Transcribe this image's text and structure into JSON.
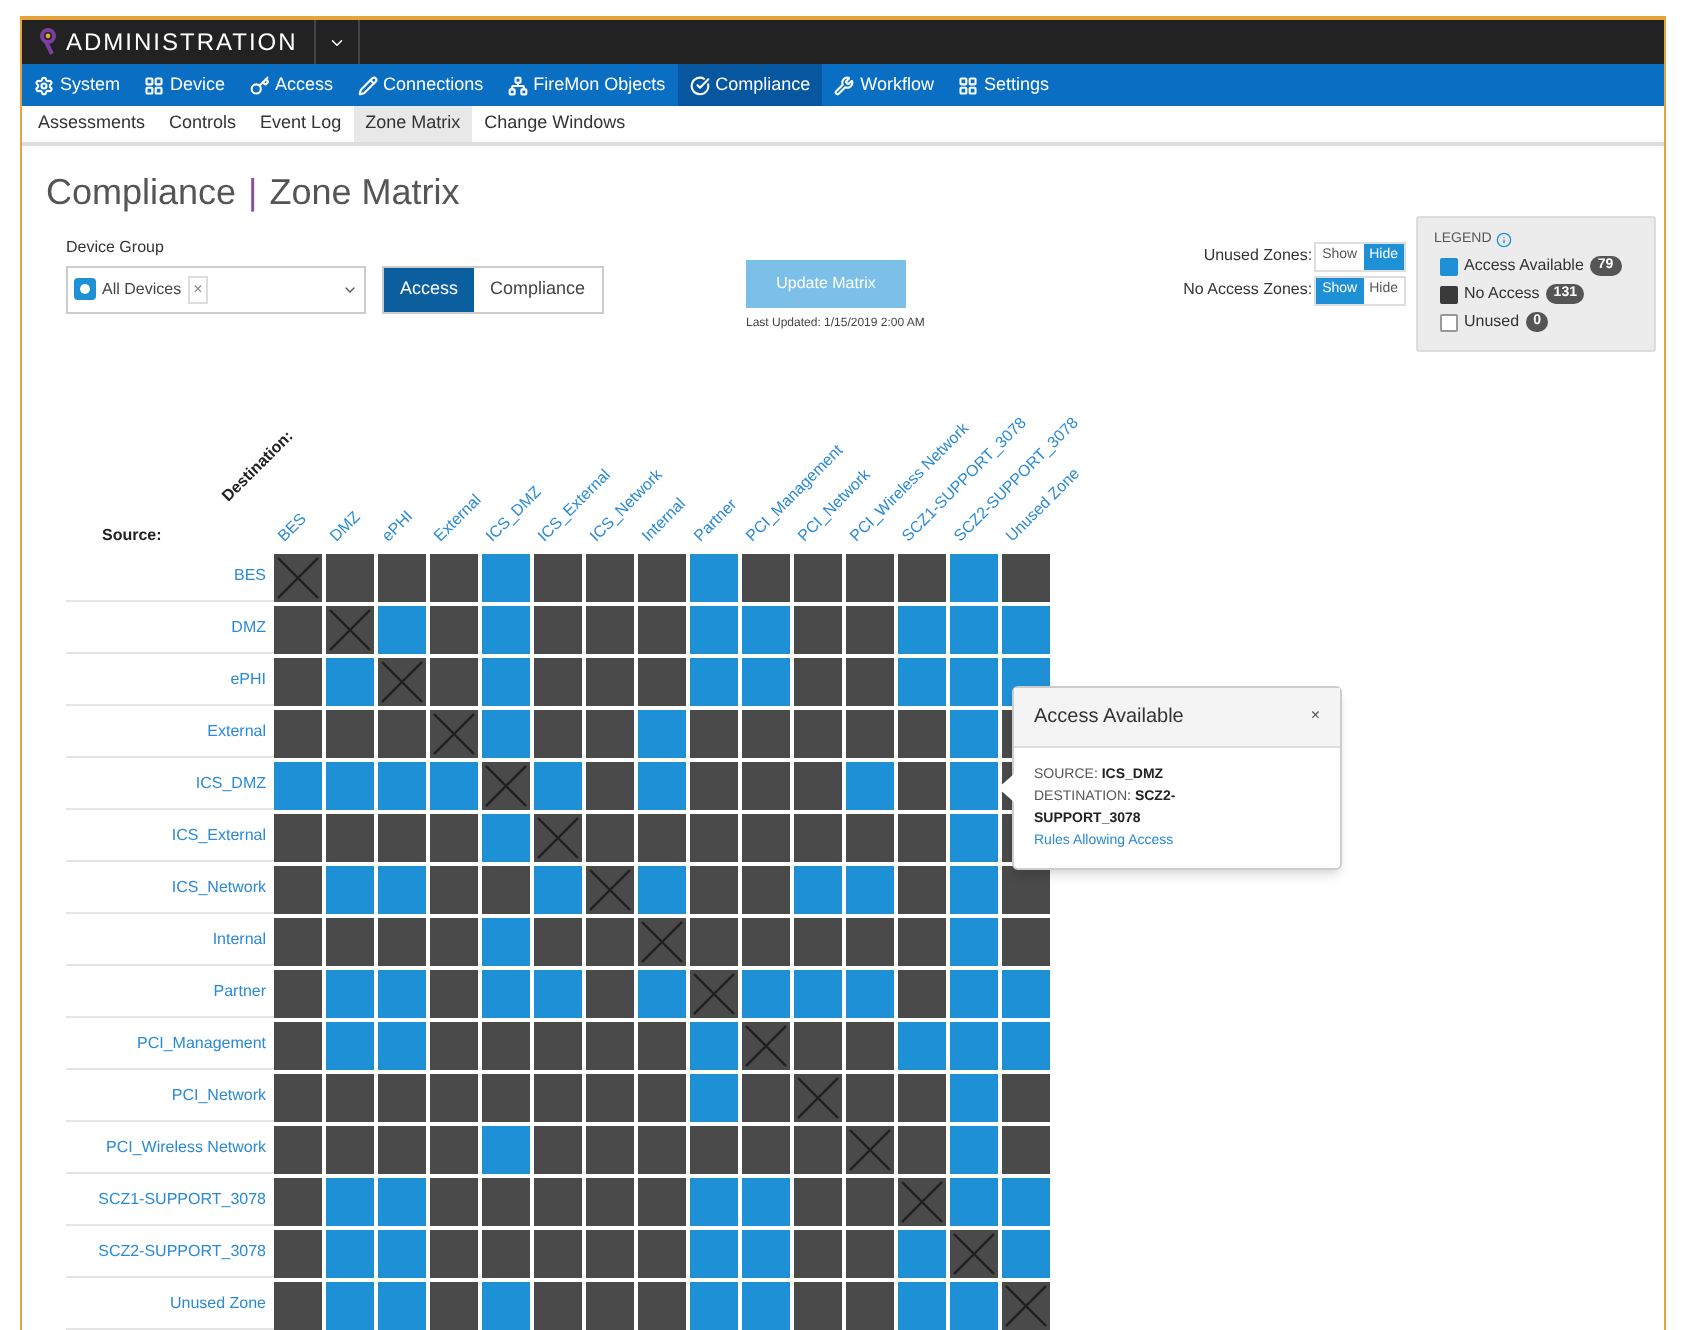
{
  "header": {
    "title": "ADMINISTRATION"
  },
  "nav": [
    {
      "label": "System",
      "selected": false
    },
    {
      "label": "Device",
      "selected": false
    },
    {
      "label": "Access",
      "selected": false
    },
    {
      "label": "Connections",
      "selected": false
    },
    {
      "label": "FireMon Objects",
      "selected": false
    },
    {
      "label": "Compliance",
      "selected": true
    },
    {
      "label": "Workflow",
      "selected": false
    },
    {
      "label": "Settings",
      "selected": false
    }
  ],
  "subnav": [
    {
      "label": "Assessments",
      "selected": false
    },
    {
      "label": "Controls",
      "selected": false
    },
    {
      "label": "Event Log",
      "selected": false
    },
    {
      "label": "Zone Matrix",
      "selected": true
    },
    {
      "label": "Change Windows",
      "selected": false
    }
  ],
  "page_title": {
    "section": "Compliance",
    "separator": "|",
    "page": "Zone Matrix"
  },
  "device_group": {
    "label": "Device Group",
    "chip": "All Devices",
    "chip_remove": "×"
  },
  "mode_toggle": [
    {
      "label": "Access",
      "selected": true
    },
    {
      "label": "Compliance",
      "selected": false
    }
  ],
  "update_button": "Update Matrix",
  "last_updated": "Last Updated: 1/15/2019 2:00 AM",
  "zone_toggles": [
    {
      "label": "Unused Zones:",
      "options": [
        {
          "label": "Show",
          "selected": false
        },
        {
          "label": "Hide",
          "selected": true
        }
      ]
    },
    {
      "label": "No Access Zones:",
      "options": [
        {
          "label": "Show",
          "selected": true
        },
        {
          "label": "Hide",
          "selected": false
        }
      ]
    }
  ],
  "legend": {
    "title": "LEGEND",
    "items": [
      {
        "kind": "access",
        "label": "Access Available",
        "count": "79"
      },
      {
        "kind": "none",
        "label": "No Access",
        "count": "131"
      },
      {
        "kind": "unused",
        "label": "Unused",
        "count": "0"
      }
    ]
  },
  "matrix": {
    "source_label": "Source:",
    "destination_label": "Destination:",
    "columns": [
      "BES",
      "DMZ",
      "ePHI",
      "External",
      "ICS_DMZ",
      "ICS_External",
      "ICS_Network",
      "Internal",
      "Partner",
      "PCI_Management",
      "PCI_Network",
      "PCI_Wireless Network",
      "SCZ1-SUPPORT_3078",
      "SCZ2-SUPPORT_3078",
      "Unused Zone"
    ],
    "rows": [
      {
        "label": "BES",
        "cells": [
          {
            "kind": "self"
          },
          {
            "kind": "none"
          },
          {
            "kind": "none"
          },
          {
            "kind": "none"
          },
          {
            "kind": "access"
          },
          {
            "kind": "none"
          },
          {
            "kind": "none"
          },
          {
            "kind": "none"
          },
          {
            "kind": "access"
          },
          {
            "kind": "none"
          },
          {
            "kind": "none"
          },
          {
            "kind": "none"
          },
          {
            "kind": "none"
          },
          {
            "kind": "access"
          },
          {
            "kind": "none"
          }
        ]
      },
      {
        "label": "DMZ",
        "cells": [
          {
            "kind": "none"
          },
          {
            "kind": "self"
          },
          {
            "kind": "access"
          },
          {
            "kind": "none"
          },
          {
            "kind": "access"
          },
          {
            "kind": "none"
          },
          {
            "kind": "none"
          },
          {
            "kind": "none"
          },
          {
            "kind": "access"
          },
          {
            "kind": "access"
          },
          {
            "kind": "none"
          },
          {
            "kind": "none"
          },
          {
            "kind": "access"
          },
          {
            "kind": "access"
          },
          {
            "kind": "access"
          }
        ]
      },
      {
        "label": "ePHI",
        "cells": [
          {
            "kind": "none"
          },
          {
            "kind": "access"
          },
          {
            "kind": "self"
          },
          {
            "kind": "none"
          },
          {
            "kind": "access"
          },
          {
            "kind": "none"
          },
          {
            "kind": "none"
          },
          {
            "kind": "none"
          },
          {
            "kind": "access"
          },
          {
            "kind": "access"
          },
          {
            "kind": "none"
          },
          {
            "kind": "none"
          },
          {
            "kind": "access"
          },
          {
            "kind": "access"
          },
          {
            "kind": "access"
          }
        ]
      },
      {
        "label": "External",
        "cells": [
          {
            "kind": "none"
          },
          {
            "kind": "none"
          },
          {
            "kind": "none"
          },
          {
            "kind": "self"
          },
          {
            "kind": "access"
          },
          {
            "kind": "none"
          },
          {
            "kind": "none"
          },
          {
            "kind": "access"
          },
          {
            "kind": "none"
          },
          {
            "kind": "none"
          },
          {
            "kind": "none"
          },
          {
            "kind": "none"
          },
          {
            "kind": "none"
          },
          {
            "kind": "access"
          },
          {
            "kind": "none"
          }
        ]
      },
      {
        "label": "ICS_DMZ",
        "cells": [
          {
            "kind": "access"
          },
          {
            "kind": "access"
          },
          {
            "kind": "access"
          },
          {
            "kind": "access"
          },
          {
            "kind": "self"
          },
          {
            "kind": "access"
          },
          {
            "kind": "none"
          },
          {
            "kind": "access"
          },
          {
            "kind": "none"
          },
          {
            "kind": "none"
          },
          {
            "kind": "none"
          },
          {
            "kind": "access"
          },
          {
            "kind": "none"
          },
          {
            "kind": "access"
          },
          {
            "kind": "none"
          }
        ]
      },
      {
        "label": "ICS_External",
        "cells": [
          {
            "kind": "none"
          },
          {
            "kind": "none"
          },
          {
            "kind": "none"
          },
          {
            "kind": "none"
          },
          {
            "kind": "access"
          },
          {
            "kind": "self"
          },
          {
            "kind": "none"
          },
          {
            "kind": "none"
          },
          {
            "kind": "none"
          },
          {
            "kind": "none"
          },
          {
            "kind": "none"
          },
          {
            "kind": "none"
          },
          {
            "kind": "none"
          },
          {
            "kind": "access"
          },
          {
            "kind": "none"
          }
        ]
      },
      {
        "label": "ICS_Network",
        "cells": [
          {
            "kind": "none"
          },
          {
            "kind": "access"
          },
          {
            "kind": "access"
          },
          {
            "kind": "none"
          },
          {
            "kind": "none"
          },
          {
            "kind": "access"
          },
          {
            "kind": "self"
          },
          {
            "kind": "access"
          },
          {
            "kind": "none"
          },
          {
            "kind": "none"
          },
          {
            "kind": "access"
          },
          {
            "kind": "access"
          },
          {
            "kind": "none"
          },
          {
            "kind": "access"
          },
          {
            "kind": "none"
          }
        ]
      },
      {
        "label": "Internal",
        "cells": [
          {
            "kind": "none"
          },
          {
            "kind": "none"
          },
          {
            "kind": "none"
          },
          {
            "kind": "none"
          },
          {
            "kind": "access"
          },
          {
            "kind": "none"
          },
          {
            "kind": "none"
          },
          {
            "kind": "self"
          },
          {
            "kind": "none"
          },
          {
            "kind": "none"
          },
          {
            "kind": "none"
          },
          {
            "kind": "none"
          },
          {
            "kind": "none"
          },
          {
            "kind": "access"
          },
          {
            "kind": "none"
          }
        ]
      },
      {
        "label": "Partner",
        "cells": [
          {
            "kind": "none"
          },
          {
            "kind": "access"
          },
          {
            "kind": "access"
          },
          {
            "kind": "none"
          },
          {
            "kind": "access"
          },
          {
            "kind": "access"
          },
          {
            "kind": "none"
          },
          {
            "kind": "access"
          },
          {
            "kind": "self"
          },
          {
            "kind": "access"
          },
          {
            "kind": "access"
          },
          {
            "kind": "access"
          },
          {
            "kind": "none"
          },
          {
            "kind": "access"
          },
          {
            "kind": "access"
          }
        ]
      },
      {
        "label": "PCI_Management",
        "cells": [
          {
            "kind": "none"
          },
          {
            "kind": "access"
          },
          {
            "kind": "access"
          },
          {
            "kind": "none"
          },
          {
            "kind": "none"
          },
          {
            "kind": "none"
          },
          {
            "kind": "none"
          },
          {
            "kind": "none"
          },
          {
            "kind": "access"
          },
          {
            "kind": "self"
          },
          {
            "kind": "none"
          },
          {
            "kind": "none"
          },
          {
            "kind": "access"
          },
          {
            "kind": "access"
          },
          {
            "kind": "access"
          }
        ]
      },
      {
        "label": "PCI_Network",
        "cells": [
          {
            "kind": "none"
          },
          {
            "kind": "none"
          },
          {
            "kind": "none"
          },
          {
            "kind": "none"
          },
          {
            "kind": "none"
          },
          {
            "kind": "none"
          },
          {
            "kind": "none"
          },
          {
            "kind": "none"
          },
          {
            "kind": "access"
          },
          {
            "kind": "none"
          },
          {
            "kind": "self"
          },
          {
            "kind": "none"
          },
          {
            "kind": "none"
          },
          {
            "kind": "access"
          },
          {
            "kind": "none"
          }
        ]
      },
      {
        "label": "PCI_Wireless Network",
        "cells": [
          {
            "kind": "none"
          },
          {
            "kind": "none"
          },
          {
            "kind": "none"
          },
          {
            "kind": "none"
          },
          {
            "kind": "access"
          },
          {
            "kind": "none"
          },
          {
            "kind": "none"
          },
          {
            "kind": "none"
          },
          {
            "kind": "none"
          },
          {
            "kind": "none"
          },
          {
            "kind": "none"
          },
          {
            "kind": "self"
          },
          {
            "kind": "none"
          },
          {
            "kind": "access"
          },
          {
            "kind": "none"
          }
        ]
      },
      {
        "label": "SCZ1-SUPPORT_3078",
        "cells": [
          {
            "kind": "none"
          },
          {
            "kind": "access"
          },
          {
            "kind": "access"
          },
          {
            "kind": "none"
          },
          {
            "kind": "none"
          },
          {
            "kind": "none"
          },
          {
            "kind": "none"
          },
          {
            "kind": "none"
          },
          {
            "kind": "access"
          },
          {
            "kind": "access"
          },
          {
            "kind": "none"
          },
          {
            "kind": "none"
          },
          {
            "kind": "self"
          },
          {
            "kind": "access"
          },
          {
            "kind": "access"
          }
        ]
      },
      {
        "label": "SCZ2-SUPPORT_3078",
        "cells": [
          {
            "kind": "none"
          },
          {
            "kind": "access"
          },
          {
            "kind": "access"
          },
          {
            "kind": "none"
          },
          {
            "kind": "none"
          },
          {
            "kind": "none"
          },
          {
            "kind": "none"
          },
          {
            "kind": "none"
          },
          {
            "kind": "access"
          },
          {
            "kind": "access"
          },
          {
            "kind": "none"
          },
          {
            "kind": "none"
          },
          {
            "kind": "access"
          },
          {
            "kind": "self"
          },
          {
            "kind": "access"
          }
        ]
      },
      {
        "label": "Unused Zone",
        "cells": [
          {
            "kind": "none"
          },
          {
            "kind": "access"
          },
          {
            "kind": "access"
          },
          {
            "kind": "none"
          },
          {
            "kind": "access"
          },
          {
            "kind": "none"
          },
          {
            "kind": "none"
          },
          {
            "kind": "none"
          },
          {
            "kind": "access"
          },
          {
            "kind": "access"
          },
          {
            "kind": "none"
          },
          {
            "kind": "none"
          },
          {
            "kind": "access"
          },
          {
            "kind": "access"
          },
          {
            "kind": "self"
          }
        ]
      }
    ]
  },
  "popover": {
    "title": "Access Available",
    "close": "×",
    "source": "SOURCE: **ICS_DMZ**",
    "destination": "DESTINATION: **SCZ2-SUPPORT_3078**",
    "link": "Rules Allowing Access"
  }
}
